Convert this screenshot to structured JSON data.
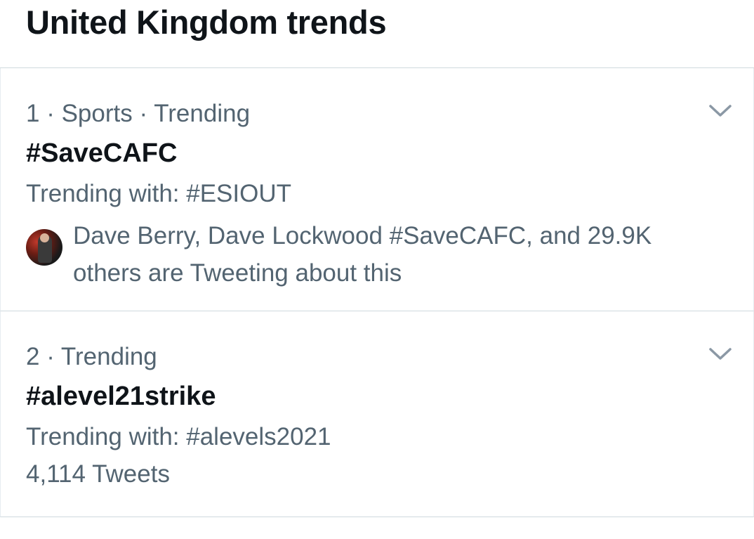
{
  "header": {
    "title": "United Kingdom trends"
  },
  "trends": [
    {
      "meta": "1 · Sports · Trending",
      "hashtag": "#SaveCAFC",
      "trending_with": "Trending with: #ESIOUT",
      "context": "Dave Berry, Dave Lockwood #SaveCAFC, and 29.9K others are Tweeting about this"
    },
    {
      "meta": "2 · Trending",
      "hashtag": "#alevel21strike",
      "trending_with": "Trending with: #alevels2021",
      "tweet_count": "4,114 Tweets"
    }
  ],
  "icons": {
    "more": "chevron-down-icon",
    "avatar": "avatar"
  },
  "colors": {
    "primary_text": "#0f1419",
    "secondary_text": "#536471",
    "divider": "#cfd9de"
  }
}
